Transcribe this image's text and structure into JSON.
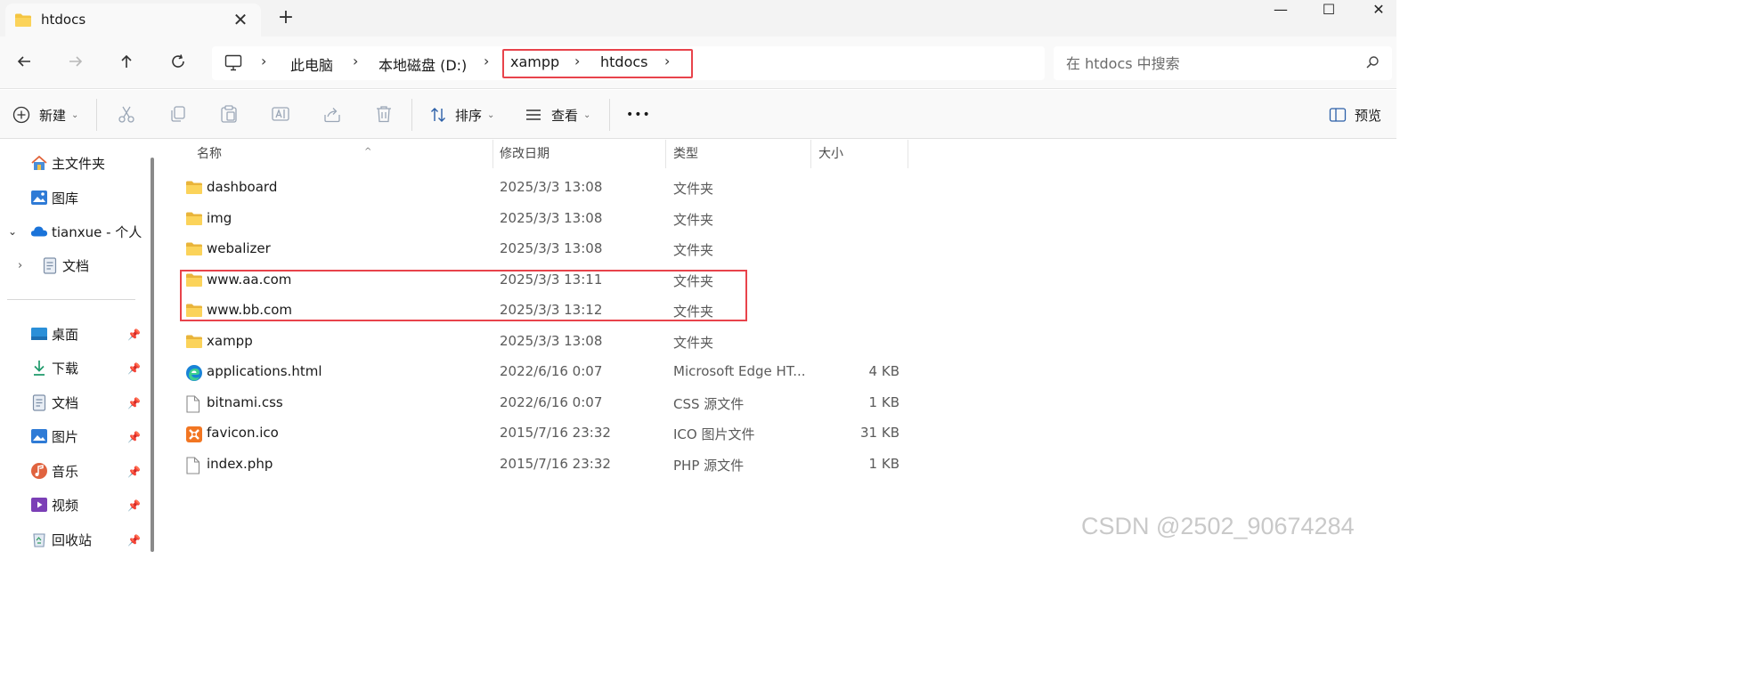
{
  "tab": {
    "title": "htdocs",
    "close_label": "✕",
    "new_tab_label": "+"
  },
  "window": {
    "minimize": "—",
    "maximize": "☐",
    "close": "✕"
  },
  "breadcrumb": [
    "此电脑",
    "本地磁盘 (D:)",
    "xampp",
    "htdocs"
  ],
  "search": {
    "placeholder": "在 htdocs 中搜索"
  },
  "toolbar": {
    "new_label": "新建",
    "sort_label": "排序",
    "view_label": "查看",
    "more_label": "•••",
    "preview_label": "预览"
  },
  "sidebar": {
    "top_items": [
      {
        "label": "主文件夹",
        "icon": "home-icon"
      },
      {
        "label": "图库",
        "icon": "gallery-icon"
      },
      {
        "label": "tianxue - 个人",
        "icon": "onedrive-icon"
      },
      {
        "label": "文档",
        "icon": "document-icon"
      }
    ],
    "pinned_items": [
      {
        "label": "桌面",
        "icon": "desktop-icon"
      },
      {
        "label": "下载",
        "icon": "download-icon"
      },
      {
        "label": "文档",
        "icon": "document-icon"
      },
      {
        "label": "图片",
        "icon": "pictures-icon"
      },
      {
        "label": "音乐",
        "icon": "music-icon"
      },
      {
        "label": "视频",
        "icon": "video-icon"
      },
      {
        "label": "回收站",
        "icon": "recycle-bin-icon"
      }
    ]
  },
  "columns": {
    "name": "名称",
    "modified": "修改日期",
    "type": "类型",
    "size": "大小"
  },
  "files": [
    {
      "name": "dashboard",
      "modified": "2025/3/3 13:08",
      "type": "文件夹",
      "size": "",
      "icon": "folder-icon"
    },
    {
      "name": "img",
      "modified": "2025/3/3 13:08",
      "type": "文件夹",
      "size": "",
      "icon": "folder-icon"
    },
    {
      "name": "webalizer",
      "modified": "2025/3/3 13:08",
      "type": "文件夹",
      "size": "",
      "icon": "folder-icon"
    },
    {
      "name": "www.aa.com",
      "modified": "2025/3/3 13:11",
      "type": "文件夹",
      "size": "",
      "icon": "folder-icon"
    },
    {
      "name": "www.bb.com",
      "modified": "2025/3/3 13:12",
      "type": "文件夹",
      "size": "",
      "icon": "folder-icon"
    },
    {
      "name": "xampp",
      "modified": "2025/3/3 13:08",
      "type": "文件夹",
      "size": "",
      "icon": "folder-icon"
    },
    {
      "name": "applications.html",
      "modified": "2022/6/16 0:07",
      "type": "Microsoft Edge HT...",
      "size": "4 KB",
      "icon": "edge-icon"
    },
    {
      "name": "bitnami.css",
      "modified": "2022/6/16 0:07",
      "type": "CSS 源文件",
      "size": "1 KB",
      "icon": "file-icon"
    },
    {
      "name": "favicon.ico",
      "modified": "2015/7/16 23:32",
      "type": "ICO 图片文件",
      "size": "31 KB",
      "icon": "xampp-icon"
    },
    {
      "name": "index.php",
      "modified": "2015/7/16 23:32",
      "type": "PHP 源文件",
      "size": "1 KB",
      "icon": "file-icon"
    }
  ],
  "watermark": "CSDN @2502_90674284",
  "colors": {
    "highlight": "#e8434b",
    "folder": "#f4c542"
  }
}
